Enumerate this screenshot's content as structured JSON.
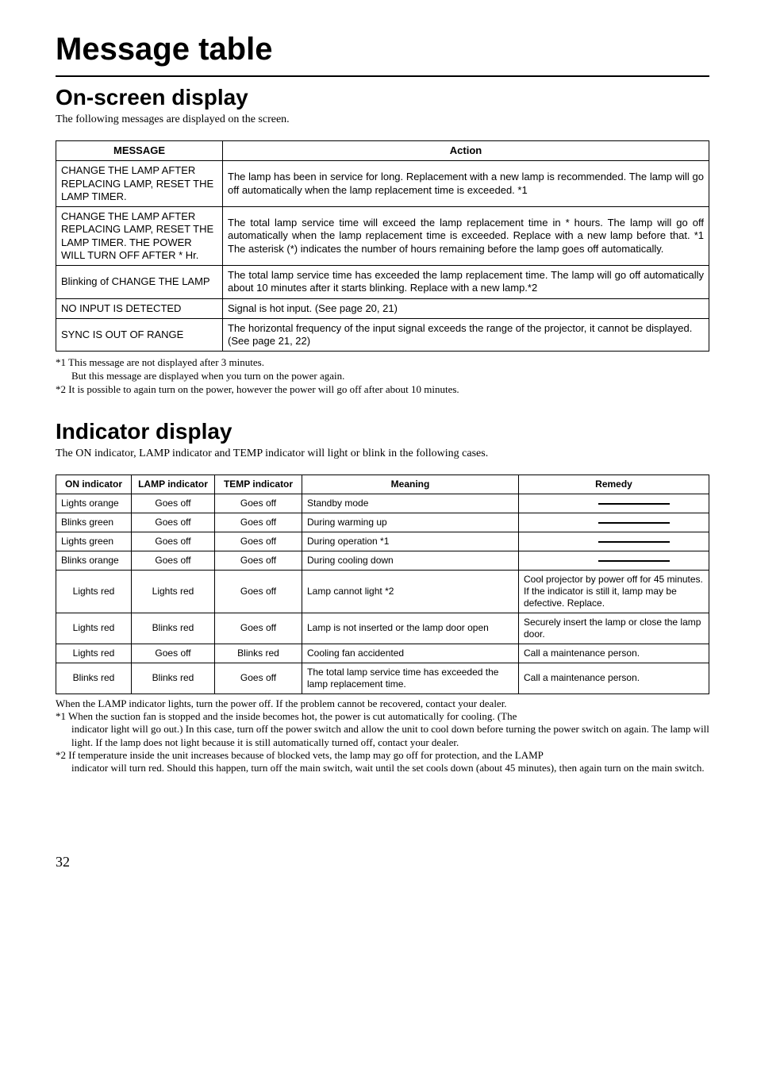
{
  "title": "Message table",
  "section1": {
    "heading": "On-screen display",
    "intro": "The following messages are displayed on the screen.",
    "headers": {
      "msg": "MESSAGE",
      "action": "Action"
    },
    "rows": [
      {
        "msg": "CHANGE THE LAMP AFTER REPLACING LAMP, RESET THE LAMP TIMER.",
        "action": "The lamp has been in service for long.  Replacement with a new lamp is recommended.  The lamp will go off automatically when the lamp replacement time is exceeded. *1"
      },
      {
        "msg": "CHANGE THE LAMP AFTER REPLACING LAMP, RESET THE LAMP TIMER. THE POWER WILL TURN OFF AFTER * Hr.",
        "action": "The total lamp service time will exceed the lamp replacement time in * hours.  The lamp will go off automatically when the lamp replacement time is exceeded.  Replace with a new lamp before that.  *1\nThe asterisk (*) indicates the number of hours remaining before the lamp goes off automatically."
      },
      {
        "msg": "Blinking of\nCHANGE THE LAMP",
        "action": "The total lamp service time has exceeded the lamp replacement time.  The lamp will go off automatically about 10 minutes after it starts blinking.  Replace with a new lamp.*2"
      },
      {
        "msg": "NO INPUT IS DETECTED",
        "action": "Signal is hot input. (See page 20, 21)"
      },
      {
        "msg": "SYNC IS OUT OF RANGE",
        "action": "The horizontal frequency of the input signal exceeds the range of the projector, it cannot be displayed. (See page 21, 22)"
      }
    ],
    "notes": [
      "*1 This message are not displayed after 3 minutes.",
      "But this message are displayed when you turn on the power again.",
      "*2 It is possible to again turn on the power, however the power will go off after about 10 minutes."
    ]
  },
  "section2": {
    "heading": "Indicator display",
    "intro": "The ON indicator, LAMP indicator and TEMP indicator will light or blink in the following cases.",
    "headers": {
      "on": "ON indicator",
      "lamp": "LAMP indicator",
      "temp": "TEMP indicator",
      "meaning": "Meaning",
      "remedy": "Remedy"
    },
    "rows": [
      {
        "on": "Lights orange",
        "lamp": "Goes off",
        "temp": "Goes off",
        "meaning": "Standby mode",
        "remedy": ""
      },
      {
        "on": "Blinks green",
        "lamp": "Goes off",
        "temp": "Goes off",
        "meaning": "During warming up",
        "remedy": ""
      },
      {
        "on": "Lights green",
        "lamp": "Goes off",
        "temp": "Goes off",
        "meaning": "During operation *1",
        "remedy": ""
      },
      {
        "on": "Blinks orange",
        "lamp": "Goes off",
        "temp": "Goes off",
        "meaning": "During cooling down",
        "remedy": ""
      },
      {
        "on": "Lights red",
        "lamp": "Lights red",
        "temp": "Goes off",
        "meaning": "Lamp cannot light *2",
        "remedy": "Cool projector by power off for 45 minutes.\nIf the indicator is still it, lamp may be defective. Replace."
      },
      {
        "on": "Lights red",
        "lamp": "Blinks red",
        "temp": "Goes off",
        "meaning": "Lamp is not inserted or the lamp door open",
        "remedy": "Securely insert the lamp or close the lamp door."
      },
      {
        "on": "Lights red",
        "lamp": "Goes off",
        "temp": "Blinks red",
        "meaning": "Cooling fan accidented",
        "remedy": "Call a maintenance person."
      },
      {
        "on": "Blinks red",
        "lamp": "Blinks red",
        "temp": "Goes off",
        "meaning": "The total lamp service time has exceeded the lamp replacement time.",
        "remedy": "Call a maintenance person."
      }
    ],
    "footnotes": [
      "When the LAMP indicator lights, turn the power off. If the problem cannot be recovered, contact your dealer.",
      "*1 When the suction fan is stopped and the inside becomes hot, the power is cut automatically for cooling. (The",
      "indicator light will go out.) In this case, turn off the power switch and allow the unit to cool down before turning the power switch on again. The lamp will light. If the lamp does not light because it is still automatically turned off, contact your dealer.",
      "*2 If temperature inside the unit increases because of blocked vets, the lamp may go off for protection, and the LAMP",
      "indicator will turn red. Should this happen, turn off the main switch, wait until the set cools down (about 45 minutes), then again turn on the main switch."
    ]
  },
  "pageNumber": "32"
}
